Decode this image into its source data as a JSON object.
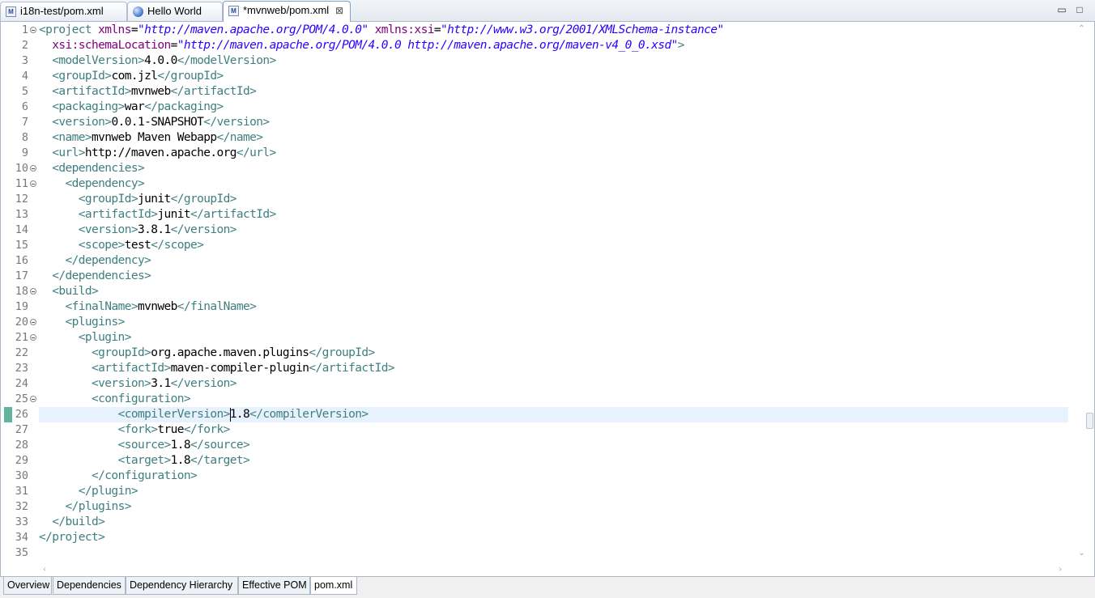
{
  "tabs": [
    {
      "label": "i18n-test/pom.xml",
      "icon": "xml-file-icon",
      "active": false
    },
    {
      "label": "Hello World",
      "icon": "globe-icon",
      "active": false
    },
    {
      "label": "*mvnweb/pom.xml",
      "icon": "xml-file-icon",
      "active": true,
      "close": "⊠"
    }
  ],
  "window_controls": {
    "minimize": "▭",
    "maximize": "□"
  },
  "editor": {
    "current_line": 26,
    "fold_lines": [
      1,
      10,
      11,
      18,
      20,
      21,
      25
    ],
    "lines": [
      [
        [
          "t",
          "<project "
        ],
        [
          "a",
          "xmlns"
        ],
        [
          "x",
          "="
        ],
        [
          "v",
          "\"http://maven.apache.org/POM/4.0.0\""
        ],
        [
          "x",
          " "
        ],
        [
          "a",
          "xmlns:xsi"
        ],
        [
          "x",
          "="
        ],
        [
          "v",
          "\"http://www.w3.org/2001/XMLSchema-instance\""
        ]
      ],
      [
        [
          "x",
          "  "
        ],
        [
          "a",
          "xsi:schemaLocation"
        ],
        [
          "x",
          "="
        ],
        [
          "v",
          "\"http://maven.apache.org/POM/4.0.0 http://maven.apache.org/maven-v4_0_0.xsd\""
        ],
        [
          "t",
          ">"
        ]
      ],
      [
        [
          "x",
          "  "
        ],
        [
          "t",
          "<modelVersion>"
        ],
        [
          "x",
          "4.0.0"
        ],
        [
          "t",
          "</modelVersion>"
        ]
      ],
      [
        [
          "x",
          "  "
        ],
        [
          "t",
          "<groupId>"
        ],
        [
          "x",
          "com.jzl"
        ],
        [
          "t",
          "</groupId>"
        ]
      ],
      [
        [
          "x",
          "  "
        ],
        [
          "t",
          "<artifactId>"
        ],
        [
          "x",
          "mvnweb"
        ],
        [
          "t",
          "</artifactId>"
        ]
      ],
      [
        [
          "x",
          "  "
        ],
        [
          "t",
          "<packaging>"
        ],
        [
          "x",
          "war"
        ],
        [
          "t",
          "</packaging>"
        ]
      ],
      [
        [
          "x",
          "  "
        ],
        [
          "t",
          "<version>"
        ],
        [
          "x",
          "0.0.1-SNAPSHOT"
        ],
        [
          "t",
          "</version>"
        ]
      ],
      [
        [
          "x",
          "  "
        ],
        [
          "t",
          "<name>"
        ],
        [
          "x",
          "mvnweb Maven Webapp"
        ],
        [
          "t",
          "</name>"
        ]
      ],
      [
        [
          "x",
          "  "
        ],
        [
          "t",
          "<url>"
        ],
        [
          "x",
          "http://maven.apache.org"
        ],
        [
          "t",
          "</url>"
        ]
      ],
      [
        [
          "x",
          "  "
        ],
        [
          "t",
          "<dependencies>"
        ]
      ],
      [
        [
          "x",
          "    "
        ],
        [
          "t",
          "<dependency>"
        ]
      ],
      [
        [
          "x",
          "      "
        ],
        [
          "t",
          "<groupId>"
        ],
        [
          "x",
          "junit"
        ],
        [
          "t",
          "</groupId>"
        ]
      ],
      [
        [
          "x",
          "      "
        ],
        [
          "t",
          "<artifactId>"
        ],
        [
          "x",
          "junit"
        ],
        [
          "t",
          "</artifactId>"
        ]
      ],
      [
        [
          "x",
          "      "
        ],
        [
          "t",
          "<version>"
        ],
        [
          "x",
          "3.8.1"
        ],
        [
          "t",
          "</version>"
        ]
      ],
      [
        [
          "x",
          "      "
        ],
        [
          "t",
          "<scope>"
        ],
        [
          "x",
          "test"
        ],
        [
          "t",
          "</scope>"
        ]
      ],
      [
        [
          "x",
          "    "
        ],
        [
          "t",
          "</dependency>"
        ]
      ],
      [
        [
          "x",
          "  "
        ],
        [
          "t",
          "</dependencies>"
        ]
      ],
      [
        [
          "x",
          "  "
        ],
        [
          "t",
          "<build>"
        ]
      ],
      [
        [
          "x",
          "    "
        ],
        [
          "t",
          "<finalName>"
        ],
        [
          "x",
          "mvnweb"
        ],
        [
          "t",
          "</finalName>"
        ]
      ],
      [
        [
          "x",
          "    "
        ],
        [
          "t",
          "<plugins>"
        ]
      ],
      [
        [
          "x",
          "      "
        ],
        [
          "t",
          "<plugin>"
        ]
      ],
      [
        [
          "x",
          "        "
        ],
        [
          "t",
          "<groupId>"
        ],
        [
          "x",
          "org.apache.maven.plugins"
        ],
        [
          "t",
          "</groupId>"
        ]
      ],
      [
        [
          "x",
          "        "
        ],
        [
          "t",
          "<artifactId>"
        ],
        [
          "x",
          "maven-compiler-plugin"
        ],
        [
          "t",
          "</artifactId>"
        ]
      ],
      [
        [
          "x",
          "        "
        ],
        [
          "t",
          "<version>"
        ],
        [
          "x",
          "3.1"
        ],
        [
          "t",
          "</version>"
        ]
      ],
      [
        [
          "x",
          "        "
        ],
        [
          "t",
          "<configuration>"
        ]
      ],
      [
        [
          "x",
          "            "
        ],
        [
          "t",
          "<compilerVersion>"
        ],
        [
          "x",
          "1.8"
        ],
        [
          "t",
          "</compilerVersion>"
        ]
      ],
      [
        [
          "x",
          "            "
        ],
        [
          "t",
          "<fork>"
        ],
        [
          "x",
          "true"
        ],
        [
          "t",
          "</fork>"
        ]
      ],
      [
        [
          "x",
          "            "
        ],
        [
          "t",
          "<source>"
        ],
        [
          "x",
          "1.8"
        ],
        [
          "t",
          "</source>"
        ]
      ],
      [
        [
          "x",
          "            "
        ],
        [
          "t",
          "<target>"
        ],
        [
          "x",
          "1.8"
        ],
        [
          "t",
          "</target>"
        ]
      ],
      [
        [
          "x",
          "        "
        ],
        [
          "t",
          "</configuration>"
        ]
      ],
      [
        [
          "x",
          "      "
        ],
        [
          "t",
          "</plugin>"
        ]
      ],
      [
        [
          "x",
          "    "
        ],
        [
          "t",
          "</plugins>"
        ]
      ],
      [
        [
          "x",
          "  "
        ],
        [
          "t",
          "</build>"
        ]
      ],
      [
        [
          "t",
          "</project>"
        ]
      ],
      []
    ]
  },
  "bottom_tabs": [
    {
      "label": "Overview",
      "active": false
    },
    {
      "label": "Dependencies",
      "active": false
    },
    {
      "label": "Dependency Hierarchy",
      "active": false
    },
    {
      "label": "Effective POM",
      "active": false
    },
    {
      "label": "pom.xml",
      "active": true
    }
  ],
  "colors": {
    "tag": "#3f7f7f",
    "attribute": "#7f007f",
    "value": "#2a00ff",
    "text": "#000000",
    "current_line": "#e8f2fe"
  }
}
